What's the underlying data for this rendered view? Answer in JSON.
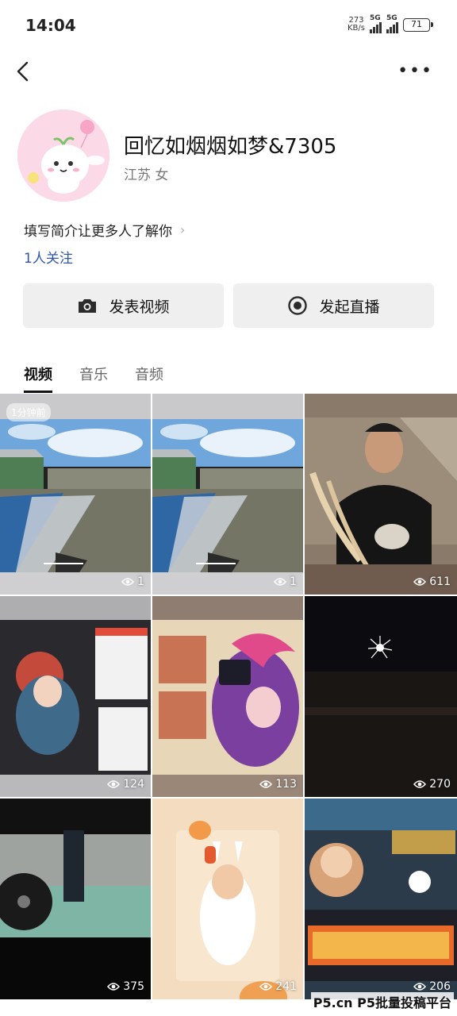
{
  "status_bar": {
    "time": "14:04",
    "net_speed_value": "273",
    "net_speed_unit": "KB/s",
    "signal_1": "5G",
    "signal_2": "5G",
    "battery": "71"
  },
  "header": {
    "back_icon": "chevron-left-icon",
    "more_icon": "more-horizontal-icon",
    "more_label": "•••"
  },
  "profile": {
    "username": "回忆如烟烟如梦&7305",
    "info": "江苏 女",
    "bio": "填写简介让更多人了解你",
    "bio_chevron": "›",
    "follows": "1人关注"
  },
  "actions": {
    "post_video": "发表视频",
    "start_live": "发起直播"
  },
  "tabs": [
    "视频",
    "音乐",
    "音频"
  ],
  "videos": [
    {
      "views": "1",
      "badge": "1分钟前",
      "thumb": "game-shooter"
    },
    {
      "views": "1",
      "thumb": "game-shooter"
    },
    {
      "views": "611",
      "thumb": "chef-noodles"
    },
    {
      "views": "124",
      "thumb": "anime-poster-1"
    },
    {
      "views": "113",
      "thumb": "anime-poster-2"
    },
    {
      "views": "270",
      "thumb": "fireworks-night"
    },
    {
      "views": "375",
      "thumb": "gym-floor"
    },
    {
      "views": "241",
      "thumb": "bunny-kid"
    },
    {
      "views": "206",
      "thumb": "game-banner"
    }
  ],
  "watermark": "P5.cn P5批量投稿平台"
}
